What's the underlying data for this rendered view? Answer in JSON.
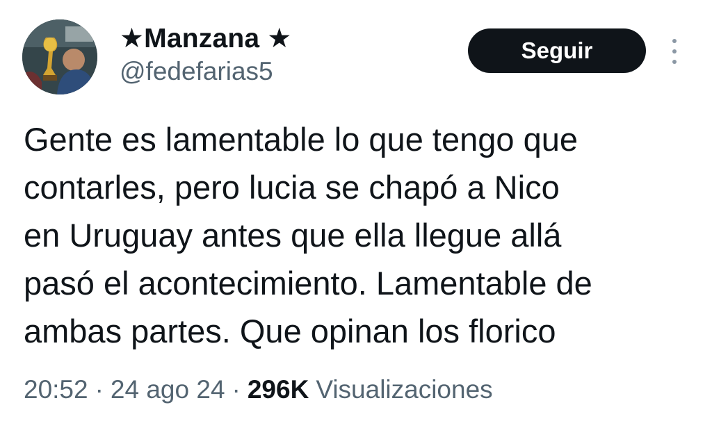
{
  "user": {
    "display_name": "★Manzana ★",
    "handle": "@fedefarias5",
    "avatar_icon": "profile-photo"
  },
  "actions": {
    "follow_label": "Seguir",
    "more_icon": "more-vertical-icon"
  },
  "tweet": {
    "text": "Gente es lamentable lo que tengo que\ncontarles, pero lucia se chapó a Nico\nen Uruguay antes que ella llegue allá\npasó el acontecimiento. Lamentable de\nambas partes. Que opinan los florico"
  },
  "meta": {
    "time": "20:52",
    "separator": "·",
    "date": "24 ago 24",
    "views_count": "296K",
    "views_label": "Visualizaciones"
  },
  "colors": {
    "text_primary": "#0f1419",
    "text_secondary": "#536471",
    "button_bg": "#0f1419",
    "button_text": "#ffffff"
  }
}
